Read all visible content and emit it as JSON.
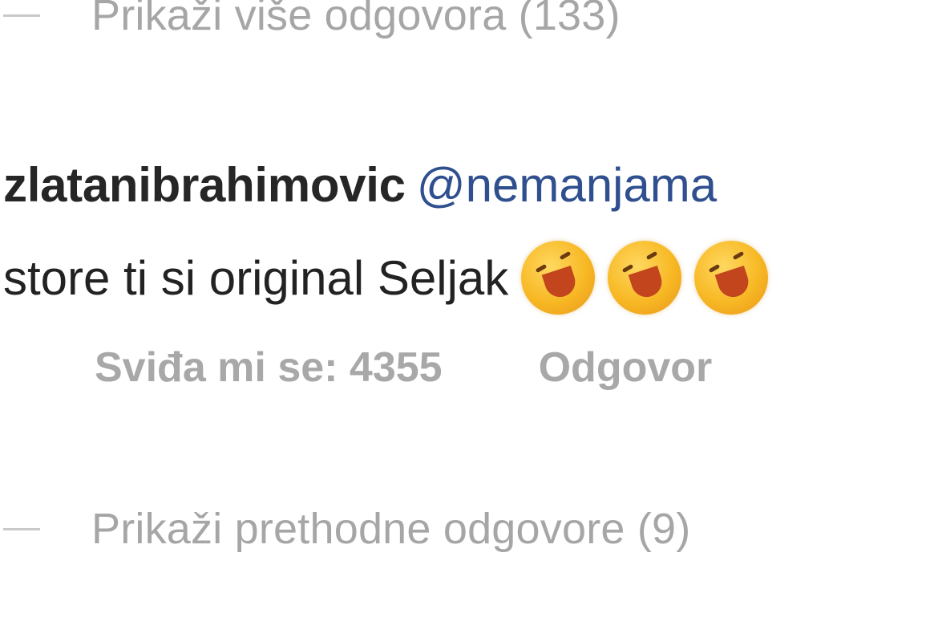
{
  "replies_toggle_top": {
    "label": "Prikaži više odgovora (133)"
  },
  "comment": {
    "username": "zlatanibrahimovic",
    "mention": "@nemanjama",
    "text": "store ti si original Seljak",
    "emoji_icon": "laughing-emoji-icon",
    "likes_label": "Sviđa mi se: 4355",
    "reply_label": "Odgovor"
  },
  "replies_toggle_bottom": {
    "label": "Prikaži prethodne odgovore (9)"
  }
}
